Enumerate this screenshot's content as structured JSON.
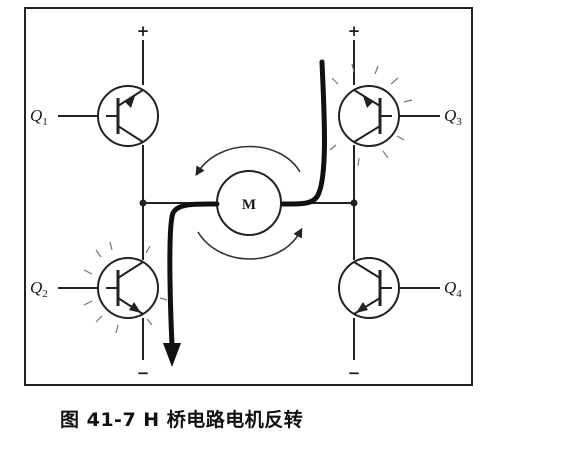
{
  "diagram": {
    "caption": "图  41-7 H 桥电路电机反转",
    "motor_label": "M",
    "supply_plus": "+",
    "supply_minus": "−",
    "transistors": [
      {
        "id": "Q1",
        "letter": "Q",
        "sub": "1",
        "state": "off"
      },
      {
        "id": "Q2",
        "letter": "Q",
        "sub": "2",
        "state": "on"
      },
      {
        "id": "Q3",
        "letter": "Q",
        "sub": "3",
        "state": "on"
      },
      {
        "id": "Q4",
        "letter": "Q",
        "sub": "4",
        "state": "off"
      }
    ]
  }
}
